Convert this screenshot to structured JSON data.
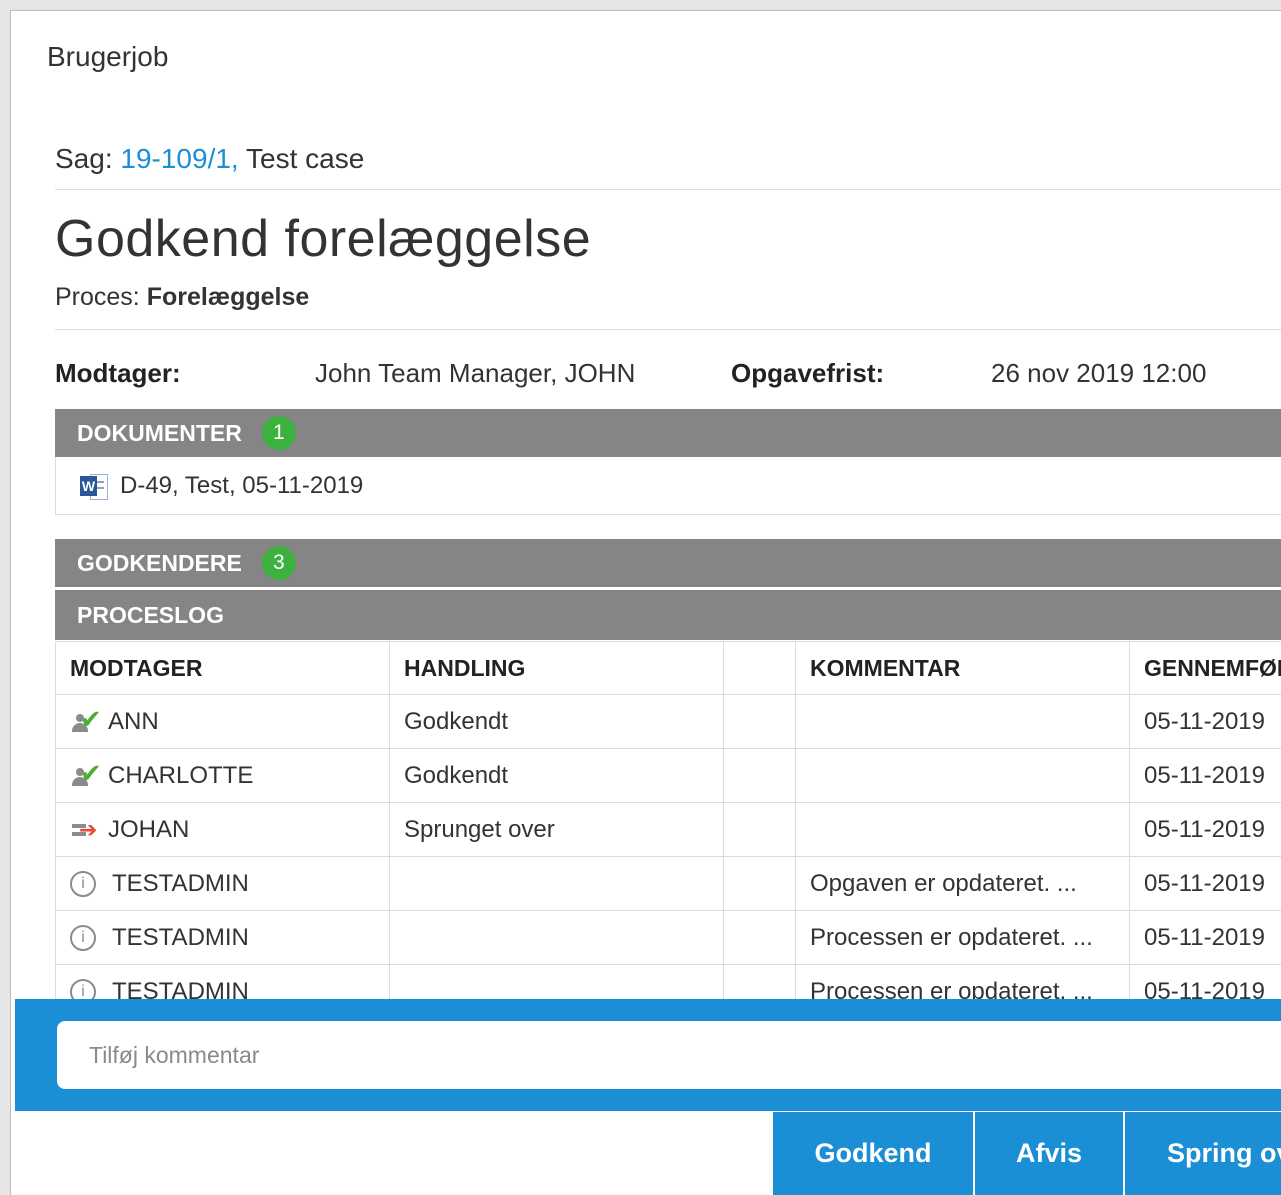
{
  "window": {
    "title": "Brugerjob"
  },
  "case": {
    "label": "Sag:",
    "link": "19-109/1,",
    "title": "Test case"
  },
  "heading": "Godkend forelæggelse",
  "process": {
    "label": "Proces:",
    "value": "Forelæggelse"
  },
  "meta": {
    "recipient_label": "Modtager:",
    "recipient_value": "John Team Manager, JOHN",
    "deadline_label": "Opgavefrist:",
    "deadline_value": "26 nov 2019 12:00"
  },
  "documents": {
    "header": "DOKUMENTER",
    "count": "1",
    "items": [
      {
        "icon": "word-document-icon",
        "label": "D-49, Test, 05-11-2019"
      }
    ]
  },
  "approvers": {
    "header": "GODKENDERE",
    "count": "3"
  },
  "process_log": {
    "header": "PROCESLOG",
    "columns": [
      "MODTAGER",
      "HANDLING",
      "",
      "KOMMENTAR",
      "GENNEMFØRT"
    ],
    "rows": [
      {
        "icon": "approved-user-icon",
        "recipient": "ANN",
        "action": "Godkendt",
        "extra": "",
        "comment": "",
        "date": "05-11-2019"
      },
      {
        "icon": "approved-user-icon",
        "recipient": "CHARLOTTE",
        "action": "Godkendt",
        "extra": "",
        "comment": "",
        "date": "05-11-2019"
      },
      {
        "icon": "skipped-user-icon",
        "recipient": "JOHAN",
        "action": "Sprunget over",
        "extra": "",
        "comment": "",
        "date": "05-11-2019"
      },
      {
        "icon": "info-icon",
        "recipient": "TESTADMIN",
        "action": "",
        "extra": "",
        "comment": "Opgaven er opdateret. ...",
        "date": "05-11-2019"
      },
      {
        "icon": "info-icon",
        "recipient": "TESTADMIN",
        "action": "",
        "extra": "",
        "comment": "Processen er opdateret. ...",
        "date": "05-11-2019"
      },
      {
        "icon": "info-icon",
        "recipient": "TESTADMIN",
        "action": "",
        "extra": "",
        "comment": "Processen er opdateret. ...",
        "date": "05-11-2019"
      }
    ]
  },
  "comment": {
    "placeholder": "Tilføj kommentar",
    "value": ""
  },
  "actions": {
    "approve": "Godkend",
    "reject": "Afvis",
    "skip": "Spring over"
  },
  "colors": {
    "accent": "#1a8fd6",
    "section_bar": "#858585",
    "badge": "#3db13d",
    "approved": "#4caf32",
    "skipped": "#e04a3a"
  }
}
